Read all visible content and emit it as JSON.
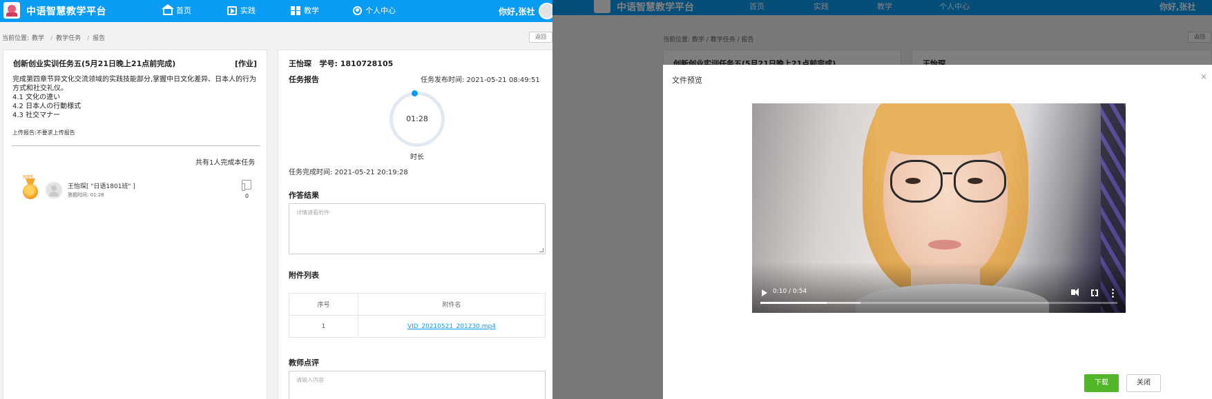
{
  "app": {
    "brand": "中语智慧教学平台",
    "greeting": "你好,张社",
    "nav": [
      {
        "label": "首页",
        "icon": "home-icon"
      },
      {
        "label": "实践",
        "icon": "play-square-icon"
      },
      {
        "label": "教学",
        "icon": "grid-icon"
      },
      {
        "label": "个人中心",
        "icon": "user-circle-icon"
      }
    ],
    "accent_color": "#0a9cf5"
  },
  "breadcrumb": {
    "prefix": "当前位置:",
    "items": [
      "教学",
      "教学任务",
      "报告"
    ],
    "separator": "/",
    "back_label": "返回"
  },
  "task": {
    "title": "创新创业实训任务五(5月21日晚上21点前完成)",
    "tag": "[作业]",
    "description": [
      "完成第四章节异文化交流领域的实践技能部分,掌握中日文化差异、日本人的行为方式和社交礼仪。",
      "4.1 文化の違い",
      "4.2 日本人の行動様式",
      "4.3 社交マナー"
    ],
    "upload_note": "上传报告:不要求上传报告",
    "done_count": "共有1人完成本任务",
    "student": {
      "medal_label": "完成奖",
      "name": "王怡琛[ \"日语1801班\" ]",
      "answer_time": "答题时间: 01:28",
      "likes": "0"
    }
  },
  "report": {
    "student_name": "王怡琛",
    "student_id": "学号: 1810728105",
    "report_label": "任务报告",
    "publish_time": "任务发布时间: 2021-05-21 08:49:51",
    "duration_value": "01:28",
    "duration_label": "时长",
    "complete_time": "任务完成时间: 2021-05-21 20:19:28",
    "answer_title": "作答结果",
    "answer_placeholder": "详情请看附件",
    "attach_title": "附件列表",
    "table": {
      "headers": [
        "序号",
        "附件名"
      ],
      "rows": [
        [
          "1",
          "VID_20210521_201230.mp4"
        ]
      ]
    },
    "review_title": "教师点评",
    "review_placeholder": "请输入内容"
  },
  "modal": {
    "title": "文件预览",
    "close_glyph": "×",
    "video_time": "0:10 / 0:54",
    "video_progress": 0.185,
    "download_label": "下载",
    "close_label": "关闭",
    "download_color": "#52b52a"
  }
}
